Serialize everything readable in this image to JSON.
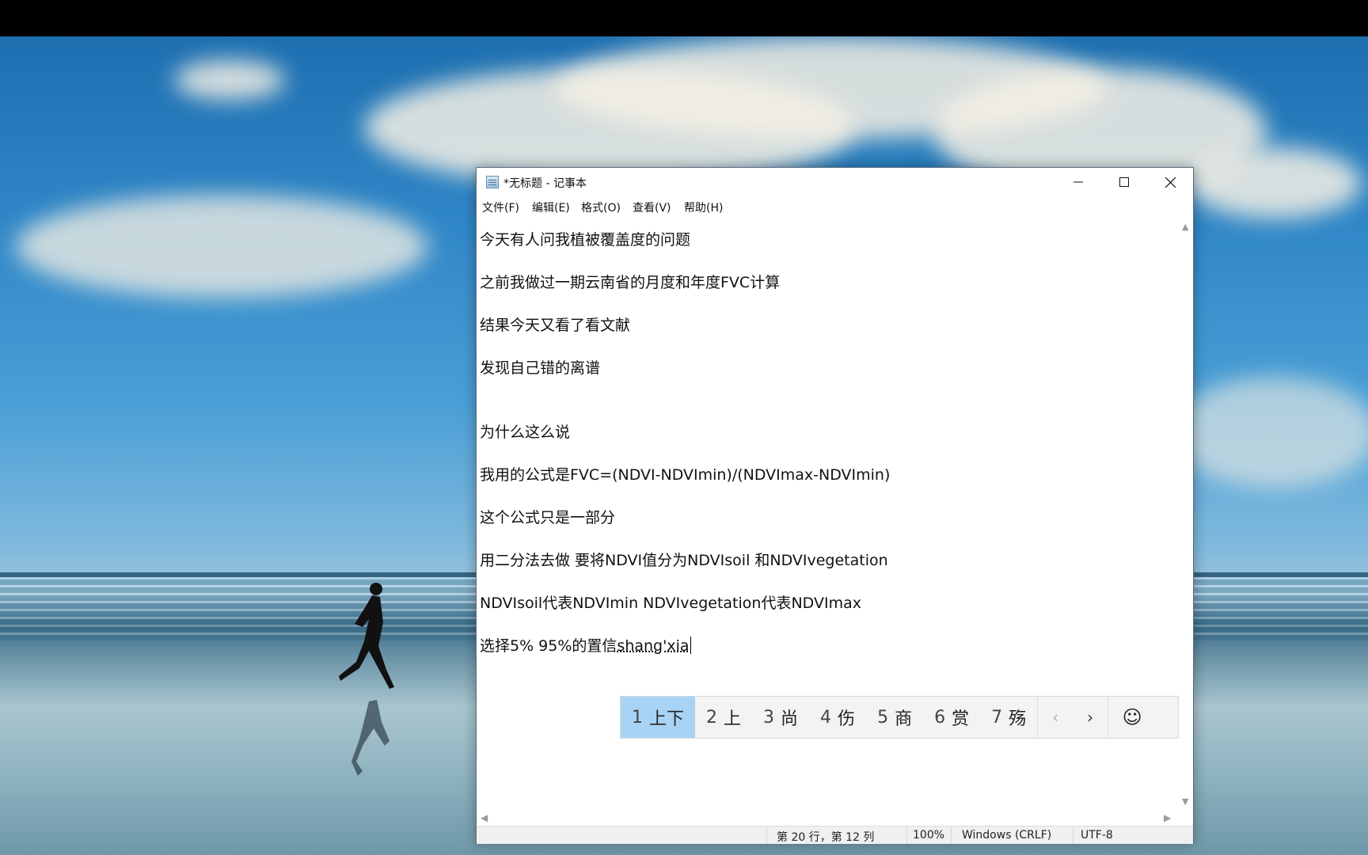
{
  "window": {
    "title": "*无标题 - 记事本",
    "controls": {
      "minimize": "minimize",
      "maximize": "maximize",
      "close": "close"
    }
  },
  "menu": [
    "文件(F)",
    "编辑(E)",
    "格式(O)",
    "查看(V)",
    "帮助(H)"
  ],
  "editor": {
    "lines": [
      "今天有人问我植被覆盖度的问题",
      "之前我做过一期云南省的月度和年度FVC计算",
      "结果今天又看了看文献",
      "发现自己错的离谱",
      "为什么这么说",
      "我用的公式是FVC=(NDVI-NDVImin)/(NDVImax-NDVImin)",
      "这个公式只是一部分",
      "用二分法去做 要将NDVI值分为NDVIsoil 和NDVIvegetation",
      "NDVIsoil代表NDVImin NDVIvegetation代表NDVImax"
    ],
    "last_line_committed": "选择5% 95%的置信",
    "last_line_composing": "shang'xia"
  },
  "ime": {
    "candidates": [
      {
        "num": "1",
        "text": "上下",
        "selected": true
      },
      {
        "num": "2",
        "text": "上",
        "selected": false
      },
      {
        "num": "3",
        "text": "尚",
        "selected": false
      },
      {
        "num": "4",
        "text": "伤",
        "selected": false
      },
      {
        "num": "5",
        "text": "商",
        "selected": false
      },
      {
        "num": "6",
        "text": "赏",
        "selected": false
      },
      {
        "num": "7",
        "text": "殇",
        "selected": false
      }
    ],
    "prev": "‹",
    "next": "›",
    "emoji": "☺",
    "selected_color": "#a9d3f5"
  },
  "status": {
    "position": "第 20 行，第 12 列",
    "zoom": "100%",
    "line_ending": "Windows (CRLF)",
    "encoding": "UTF-8"
  },
  "scroll": {
    "up": "▲",
    "down": "▼",
    "left": "◀",
    "right": "▶"
  }
}
